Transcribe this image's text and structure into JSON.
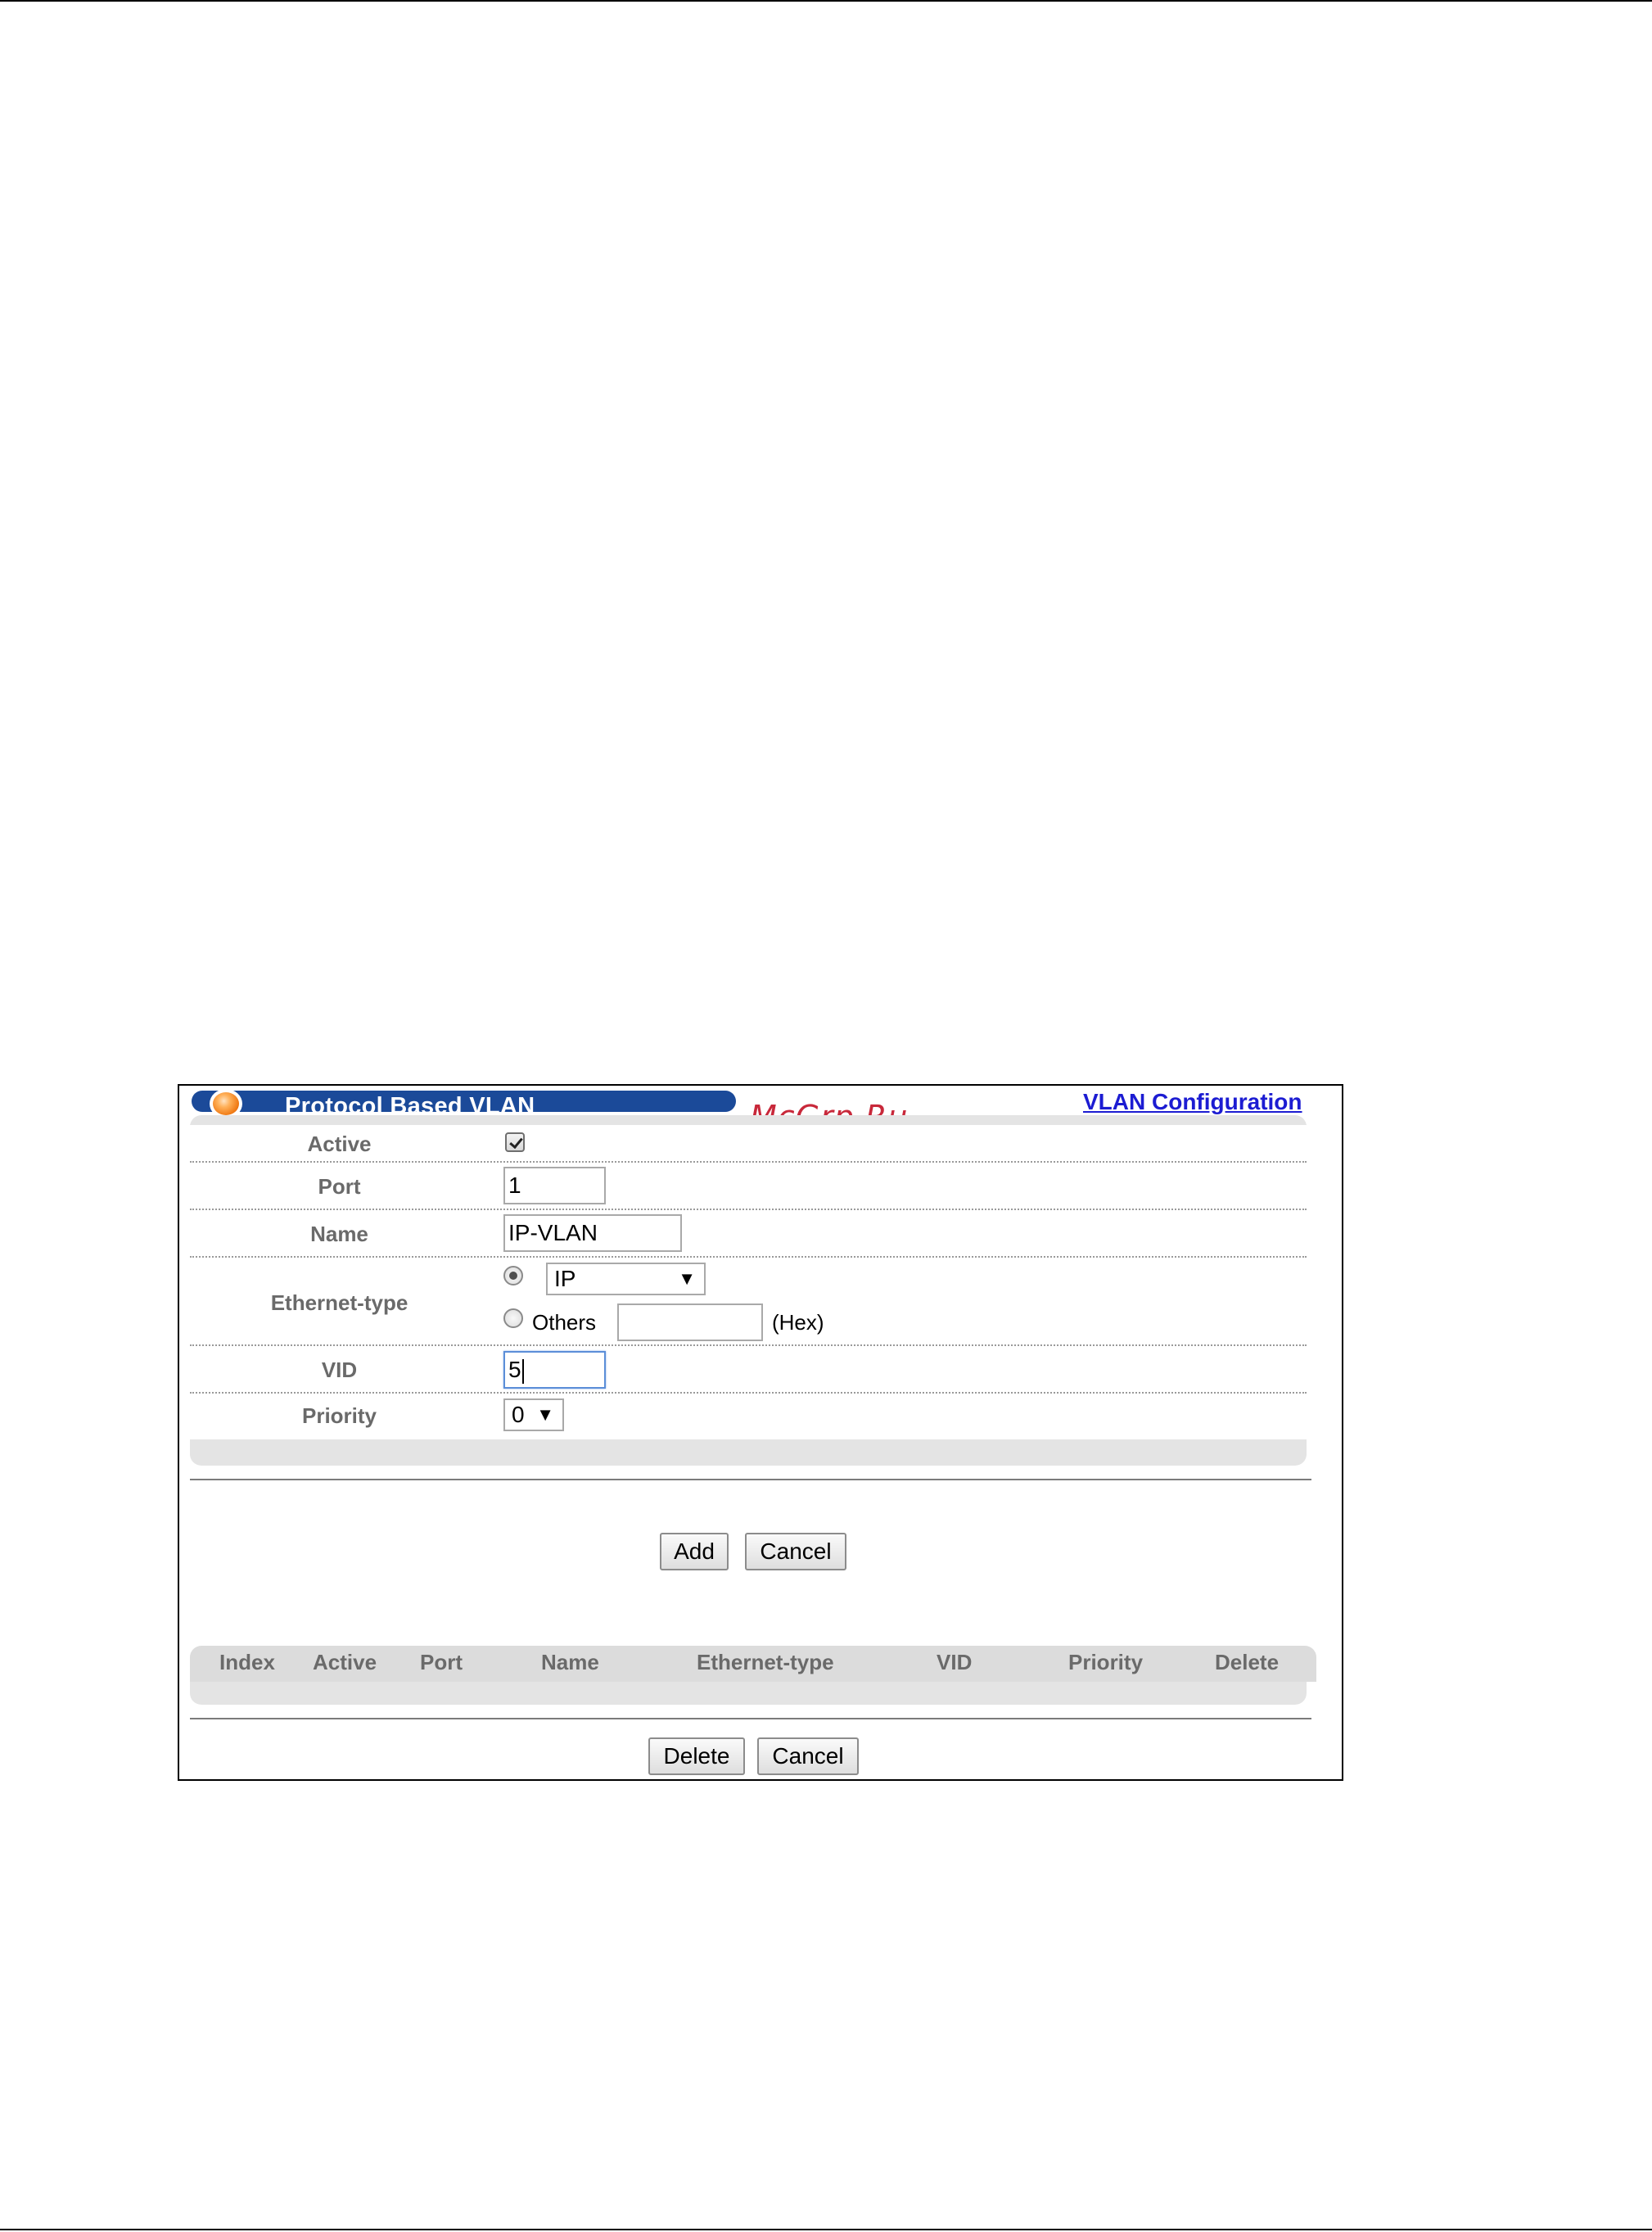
{
  "header": {
    "title": "Protocol Based VLAN",
    "watermark": "McGrp.Ru",
    "link_label": "VLAN Configuration"
  },
  "form": {
    "active": {
      "label": "Active",
      "checked": true
    },
    "port": {
      "label": "Port",
      "value": "1"
    },
    "name": {
      "label": "Name",
      "value": "IP-VLAN"
    },
    "ethernet_type": {
      "label": "Ethernet-type",
      "selected_option": "IP",
      "others_label": "Others",
      "others_value": "",
      "hex_label": "(Hex)"
    },
    "vid": {
      "label": "VID",
      "value": "5"
    },
    "priority": {
      "label": "Priority",
      "value": "0"
    }
  },
  "buttons": {
    "add": "Add",
    "cancel": "Cancel",
    "delete": "Delete",
    "cancel2": "Cancel"
  },
  "table": {
    "columns": [
      "Index",
      "Active",
      "Port",
      "Name",
      "Ethernet-type",
      "VID",
      "Priority",
      "Delete"
    ],
    "rows": []
  },
  "colors": {
    "title_bar": "#1b4a99",
    "link": "#1c1cd2",
    "label_gray": "#6a6a6a"
  }
}
